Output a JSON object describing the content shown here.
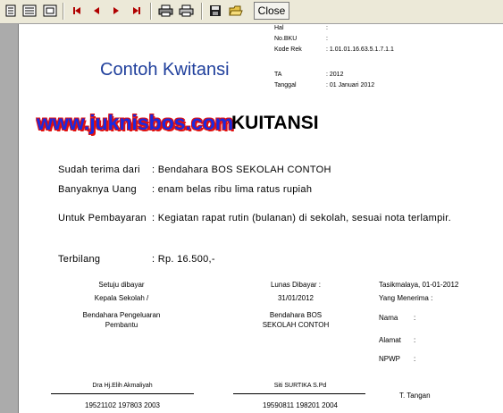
{
  "toolbar": {
    "icons": [
      "single-page-icon",
      "multi-page-icon",
      "page-width-icon",
      "first-page-icon",
      "previous-page-icon",
      "next-page-icon",
      "last-page-icon",
      "print-setup-icon",
      "print-icon",
      "save-icon",
      "open-icon"
    ],
    "close_label": "Close"
  },
  "header_info": {
    "hal_label": "Hal",
    "hal_sep": ":",
    "nobku_label": "No.BKU",
    "nobku_sep": ":",
    "koderek_label": "Kode Rek",
    "koderek_value": ":  1.01.01.16.63.5.1.7.1.1",
    "ta_label": "TA",
    "ta_value": ":  2012",
    "tanggal_label": "Tanggal",
    "tanggal_value": ":  01 Januari 2012"
  },
  "watermark_title": "Contoh Kwitansi",
  "site_banner": "www.juknisbos.com",
  "doc_title": "KUITANSI",
  "fields": {
    "sudah_label": "Sudah terima dari",
    "sudah_value": ":  Bendahara BOS SEKOLAH CONTOH",
    "banyak_label": "Banyaknya Uang",
    "banyak_value": ":   enam belas ribu lima ratus  rupiah",
    "untuk_label": "Untuk Pembayaran",
    "untuk_value": ":  Kegiatan rapat rutin (bulanan) di sekolah, sesuai nota terlampir.",
    "terbilang_label": "Terbilang",
    "terbilang_value": ":  Rp. 16.500,-"
  },
  "signatures": {
    "col1_line1": "Setuju dibayar",
    "col1_line2": "Kepala Sekolah /",
    "col1_line3": "Bendahara Pengeluaran",
    "col1_line4": "Pembantu",
    "col1_name": "Dra Hj.Elih Akmaliyah",
    "col1_nip": "19521102 197803 2003",
    "col2_line1": "Lunas Dibayar :",
    "col2_line2": "31/01/2012",
    "col2_line3": "Bendahara BOS",
    "col2_line4": "SEKOLAH CONTOH",
    "col2_name": "Siti SURTIKA S.Pd",
    "col2_nip": "19590811 198201 2004",
    "col3_place": "Tasikmalaya, 01-01-2012",
    "col3_receiver": "Yang Menerima :",
    "col3_nama": "Nama",
    "col3_nama_sep": ":",
    "col3_alamat": "Alamat",
    "col3_alamat_sep": ":",
    "col3_npwp": "NPWP",
    "col3_npwp_sep": ":",
    "col3_ttd": "T. Tangan"
  },
  "colors": {
    "watermark": "#1f3f9c",
    "banner_text": "#1a2ae0",
    "banner_shadow": "#e01010"
  }
}
